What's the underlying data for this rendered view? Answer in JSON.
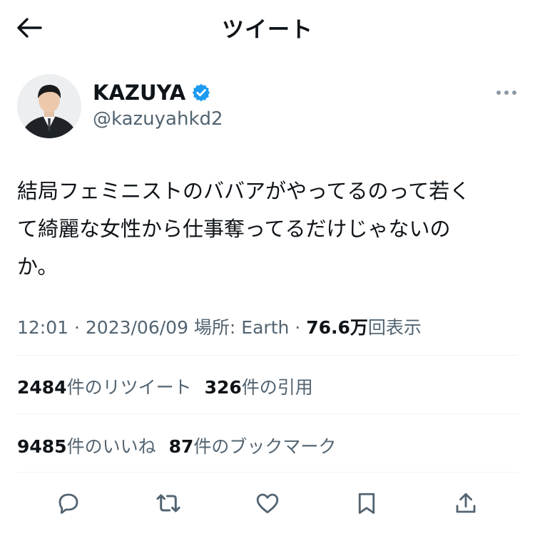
{
  "header": {
    "title": "ツイート",
    "back_icon": "arrow-left-icon"
  },
  "author": {
    "name": "KAZUYA",
    "handle": "@kazuyahkd2",
    "verified_icon": "verified-badge-icon",
    "verified_color": "#1d9bf0"
  },
  "tweet": {
    "lines": [
      "結局フェミニストのババアがやってるのって若く",
      "て綺麗な女性から仕事奪ってるだけじゃないの",
      "か。"
    ]
  },
  "meta": {
    "time": "12:01",
    "sep1": " · ",
    "date": "2023/06/09",
    "location_label": " 場所: Earth",
    "sep2": " · ",
    "views_count": "76.6万",
    "views_label": "回表示"
  },
  "stats": {
    "retweets_count": "2484",
    "retweets_label": "件のリツイート",
    "quotes_count": "326",
    "quotes_label": "件の引用",
    "likes_count": "9485",
    "likes_label": "件のいいね",
    "bookmarks_count": "87",
    "bookmarks_label": "件のブックマーク"
  },
  "actions": [
    "reply-icon",
    "retweet-icon",
    "like-icon",
    "bookmark-icon",
    "share-icon"
  ],
  "colors": {
    "text": "#0f1419",
    "secondary": "#536471",
    "divider": "#eff3f4"
  }
}
